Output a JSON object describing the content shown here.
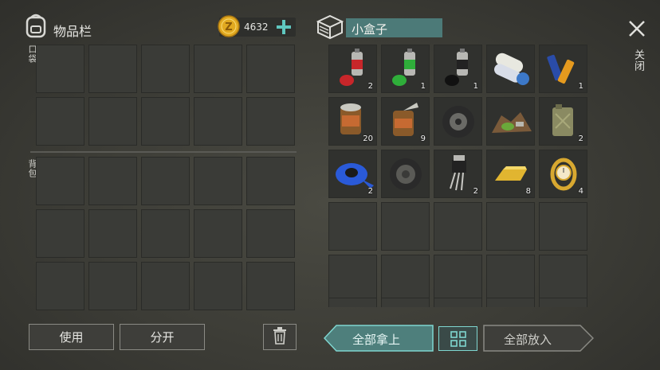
{
  "left_panel": {
    "title": "物品栏",
    "currency_amount": "4632",
    "pockets_label": "口袋",
    "backpack_label": "背包",
    "use_button": "使用",
    "split_button": "分开"
  },
  "right_panel": {
    "title": "小盒子",
    "take_all_button": "全部拿上",
    "put_all_button": "全部放入",
    "close_label": "关闭",
    "items": [
      {
        "name": "red spray paint",
        "count": "2",
        "color": "#c8262a"
      },
      {
        "name": "green spray paint",
        "count": "1",
        "color": "#2fae3a"
      },
      {
        "name": "black spray paint",
        "count": "1",
        "color": "#1a1a1a"
      },
      {
        "name": "paper rolls",
        "count": ""
      },
      {
        "name": "batteries",
        "count": "1"
      },
      {
        "name": "canned food",
        "count": "20"
      },
      {
        "name": "opened can",
        "count": "9"
      },
      {
        "name": "tire",
        "count": ""
      },
      {
        "name": "scrap pile",
        "count": ""
      },
      {
        "name": "jerrycan",
        "count": "2"
      },
      {
        "name": "blue tape",
        "count": "2"
      },
      {
        "name": "wheel",
        "count": ""
      },
      {
        "name": "transistor",
        "count": "2"
      },
      {
        "name": "gold bar",
        "count": "8"
      },
      {
        "name": "gold watch",
        "count": "4"
      }
    ]
  },
  "colors": {
    "accent_teal": "#7fd6d0",
    "title_bar": "#4c7a78",
    "coin_gold": "#e1a920"
  },
  "icons": {
    "backpack": "backpack-icon",
    "coin": "coin-icon",
    "add": "plus-icon",
    "box": "box-icon",
    "trash": "trash-icon",
    "grid": "grid-view-icon",
    "close": "close-icon"
  }
}
